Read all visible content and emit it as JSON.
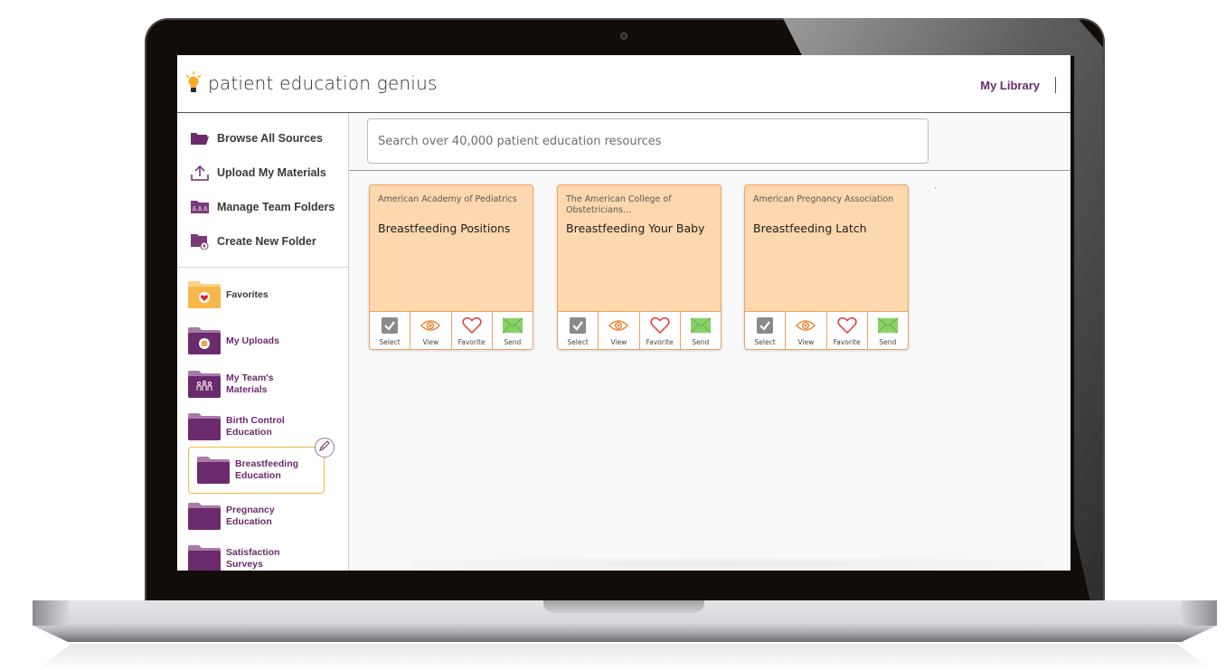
{
  "app": {
    "title": "patient education genius",
    "nav_right": {
      "my_library": "My Library"
    }
  },
  "colors": {
    "brand_purple": "#6b2a6b",
    "favorites_yellow": "#f7b84b",
    "card_bg": "#fdd7ad",
    "card_border": "#f0a262",
    "selected_border": "#f0b93b",
    "send_green": "#8bd16a",
    "view_orange": "#f07a22",
    "favorite_red": "#e23b3b"
  },
  "sidebar": {
    "actions": [
      {
        "label": "Browse All Sources",
        "icon": "open-folder-icon"
      },
      {
        "label": "Upload My Materials",
        "icon": "upload-icon"
      },
      {
        "label": "Manage Team Folders",
        "icon": "team-folder-icon"
      },
      {
        "label": "Create New Folder",
        "icon": "new-folder-icon"
      }
    ],
    "folders": [
      {
        "line1": "Favorites",
        "line2": "",
        "icon": "heart-folder-icon"
      },
      {
        "line1": "My Uploads",
        "line2": "",
        "icon": "uploads-folder-icon"
      },
      {
        "line1": "My Team's",
        "line2": "Materials",
        "icon": "team-folder-icon"
      },
      {
        "line1": "Birth Control",
        "line2": "Education",
        "icon": "folder-icon"
      },
      {
        "line1": "Breastfeeding",
        "line2": "Education",
        "icon": "folder-icon",
        "selected": true
      },
      {
        "line1": "Pregnancy",
        "line2": "Education",
        "icon": "folder-icon"
      },
      {
        "line1": "Satisfaction",
        "line2": "Surveys",
        "icon": "folder-icon"
      }
    ]
  },
  "search": {
    "placeholder": "Search over 40,000 patient education resources",
    "value": ""
  },
  "cards": [
    {
      "source": "American Academy of Pediatrics",
      "title": "Breastfeeding Positions",
      "actions": {
        "select": "Select",
        "view": "View",
        "favorite": "Favorite",
        "send": "Send"
      }
    },
    {
      "source": "The American College of Obstetricians...",
      "title": "Breastfeeding Your Baby",
      "actions": {
        "select": "Select",
        "view": "View",
        "favorite": "Favorite",
        "send": "Send"
      }
    },
    {
      "source": "American Pregnancy Association",
      "title": "Breastfeeding Latch",
      "actions": {
        "select": "Select",
        "view": "View",
        "favorite": "Favorite",
        "send": "Send"
      }
    }
  ]
}
